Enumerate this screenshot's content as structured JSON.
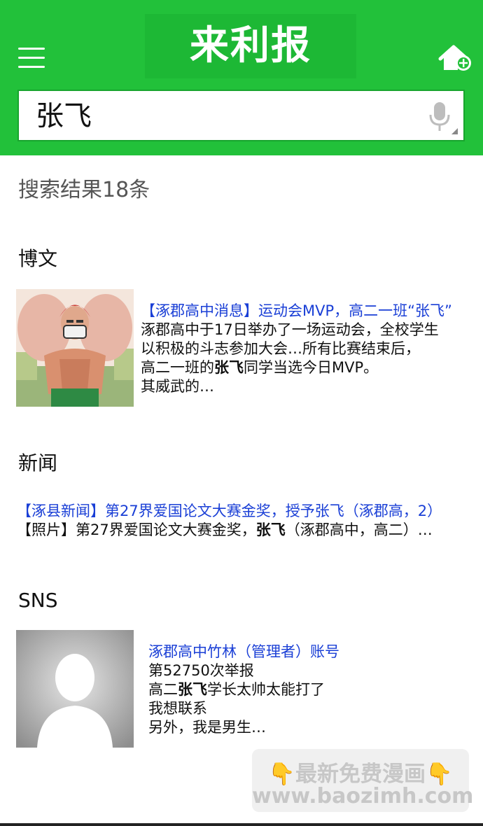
{
  "header": {
    "title": "来利报",
    "menu_icon": "hamburger-menu-icon",
    "home_add_icon": "home-add-icon",
    "colors": {
      "bar": "#22c13a",
      "title_band": "#1db835"
    }
  },
  "search": {
    "query": "张飞",
    "mic_icon": "microphone-icon"
  },
  "results": {
    "count_label": "搜索结果18条"
  },
  "sections": {
    "blog": {
      "title": "博文",
      "item": {
        "headline": "【涿郡高中消息】运动会MVP，高二一班“张飞”",
        "line1": "涿郡高中于17日举办了一场运动会，全校学生",
        "line2": "以积极的斗志参加大会…所有比赛结束后，",
        "line3_pre": "高二一班的",
        "line3_bold": "张飞",
        "line3_post": "同学当选今日MVP。",
        "line4": "其威武的…"
      }
    },
    "news": {
      "title": "新闻",
      "line1": "【涿县新闻】第27界爱国论文大赛金奖，授予张飞（涿郡高，2）",
      "line2_pre": "【照片】第27界爱国论文大赛金奖，",
      "line2_bold": "张飞",
      "line2_post": "（涿郡高中，高二）…"
    },
    "sns": {
      "title": "SNS",
      "item": {
        "headline": "涿郡高中竹林（管理者）账号",
        "line1": "第52750次举报",
        "line2_pre": "高二",
        "line2_bold": "张飞",
        "line2_post": "学长太帅太能打了",
        "line3": "我想联系",
        "line4": "另外，我是男生…"
      }
    }
  },
  "watermark": {
    "line1": "最新免费漫画",
    "line2": "www.baozimh.com",
    "hand_icon": "pointing-down-hand-icon"
  }
}
